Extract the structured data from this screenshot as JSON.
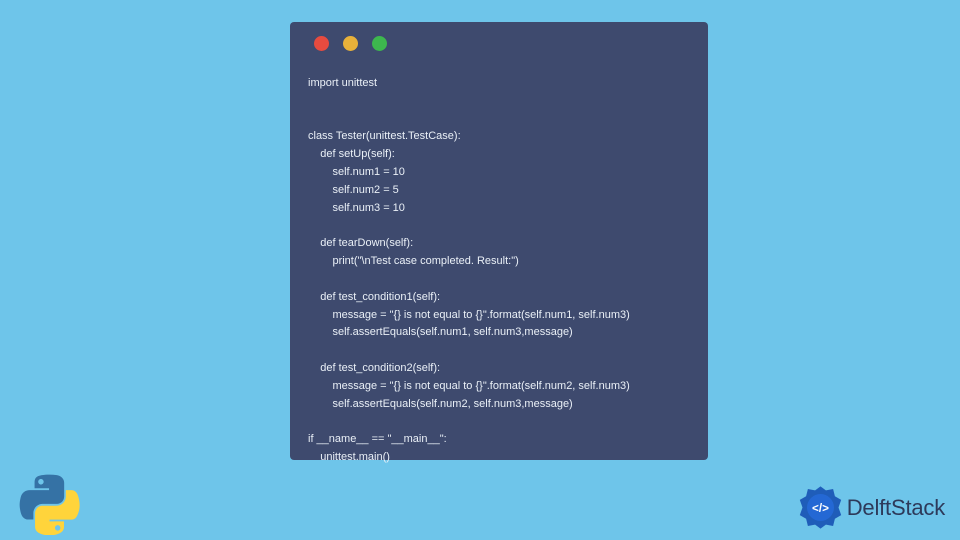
{
  "code": {
    "lines": [
      "import unittest",
      "",
      "",
      "class Tester(unittest.TestCase):",
      "    def setUp(self):",
      "        self.num1 = 10",
      "        self.num2 = 5",
      "        self.num3 = 10",
      "",
      "    def tearDown(self):",
      "        print(\"\\nTest case completed. Result:\")",
      "",
      "    def test_condition1(self):",
      "        message = \"{} is not equal to {}\".format(self.num1, self.num3)",
      "        self.assertEquals(self.num1, self.num3,message)",
      "",
      "    def test_condition2(self):",
      "        message = \"{} is not equal to {}\".format(self.num2, self.num3)",
      "        self.assertEquals(self.num2, self.num3,message)",
      "",
      "if __name__ == \"__main__\":",
      "    unittest.main()"
    ]
  },
  "brand": {
    "name": "DelftStack"
  },
  "window": {
    "dots": [
      "red",
      "yellow",
      "green"
    ]
  }
}
